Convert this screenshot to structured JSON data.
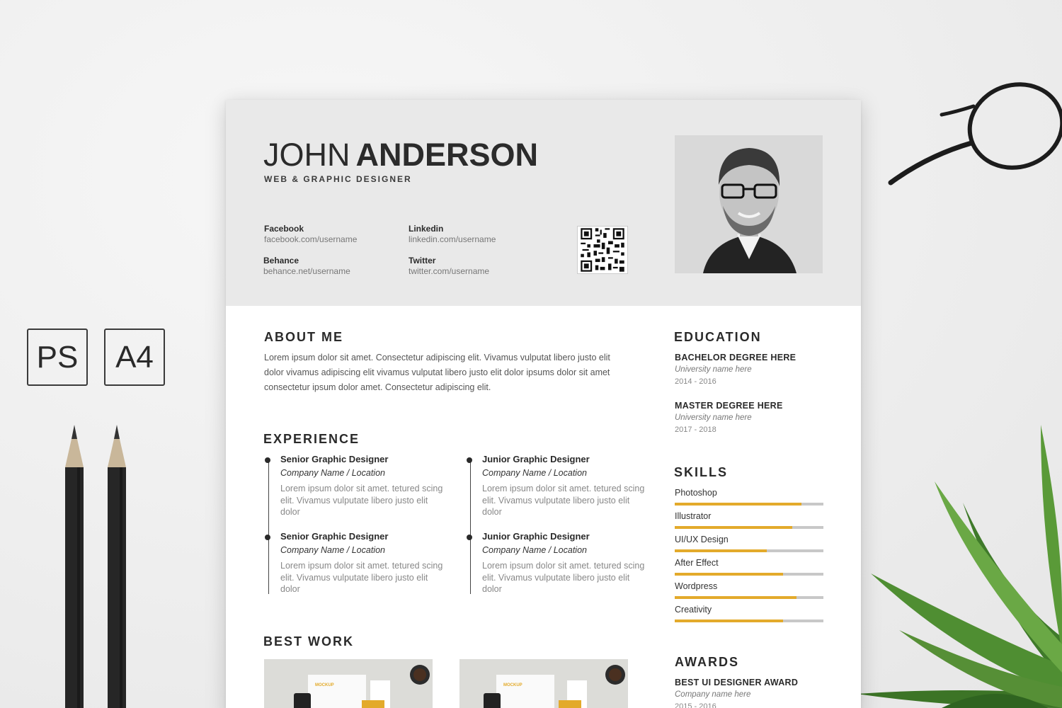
{
  "badges": {
    "ps": "PS",
    "a4": "A4"
  },
  "resume": {
    "name_first": "JOHN",
    "name_last": "ANDERSON",
    "job_title": "WEB & GRAPHIC DESIGNER",
    "contacts": [
      {
        "label": "Facebook",
        "value": "facebook.com/username"
      },
      {
        "label": "Linkedin",
        "value": "linkedin.com/username"
      },
      {
        "label": "Behance",
        "value": "behance.net/username"
      },
      {
        "label": "Twitter",
        "value": "twitter.com/username"
      }
    ],
    "about": {
      "title": "ABOUT ME",
      "text": "Lorem ipsum dolor sit amet. Consectetur adipiscing elit. Vivamus vulputat libero justo elit dolor vivamus adipiscing elit vivamus vulputat libero justo elit dolor ipsums dolor sit amet consectetur ipsum dolor amet. Consectetur adipiscing elit."
    },
    "experience": {
      "title": "EXPERIENCE",
      "items": [
        {
          "role": "Senior Graphic Designer",
          "company": "Company Name / Location",
          "desc": "Lorem ipsum dolor sit amet. tetured scing elit. Vivamus vulputate libero justo elit dolor"
        },
        {
          "role": "Senior Graphic Designer",
          "company": "Company Name / Location",
          "desc": "Lorem ipsum dolor sit amet. tetured scing elit. Vivamus vulputate libero justo elit dolor"
        },
        {
          "role": "Junior Graphic Designer",
          "company": "Company Name / Location",
          "desc": "Lorem ipsum dolor sit amet. tetured scing elit. Vivamus vulputate libero justo elit dolor"
        },
        {
          "role": "Junior Graphic Designer",
          "company": "Company Name / Location",
          "desc": "Lorem ipsum dolor sit amet. tetured scing elit. Vivamus vulputate libero justo elit dolor"
        }
      ]
    },
    "best_work": {
      "title": "BEST WORK",
      "mockup_label": "MOCKUP"
    },
    "education": {
      "title": "EDUCATION",
      "items": [
        {
          "degree": "BACHELOR DEGREE HERE",
          "university": "University name here",
          "years": "2014 - 2016"
        },
        {
          "degree": "MASTER DEGREE HERE",
          "university": "University name here",
          "years": "2017 - 2018"
        }
      ]
    },
    "skills": {
      "title": "SKILLS",
      "items": [
        {
          "name": "Photoshop",
          "level": 0.85
        },
        {
          "name": "Illustrator",
          "level": 0.79
        },
        {
          "name": "UI/UX Design",
          "level": 0.62
        },
        {
          "name": "After Effect",
          "level": 0.73
        },
        {
          "name": "Wordpress",
          "level": 0.82
        },
        {
          "name": "Creativity",
          "level": 0.73
        }
      ]
    },
    "awards": {
      "title": "AWARDS",
      "award": "BEST UI DESIGNER  AWARD",
      "company": "Company name here",
      "years": "2015 - 2016"
    }
  },
  "colors": {
    "accent": "#e3aa2b",
    "header_bg": "#e9e9e9",
    "text_dark": "#2a2a2a"
  }
}
